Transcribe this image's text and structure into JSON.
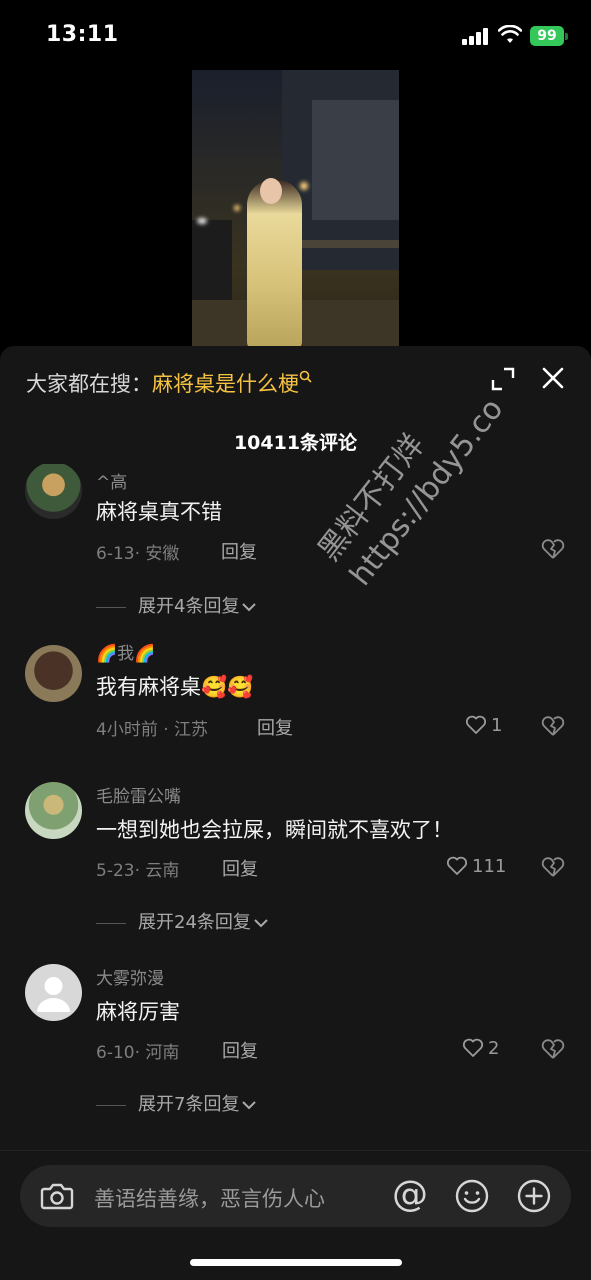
{
  "status_bar": {
    "time": "13:11",
    "battery": "99"
  },
  "video": {
    "icon": "video-thumbnail"
  },
  "search_banner": {
    "prefix": "大家都在搜：",
    "term": "麻将桌是什么梗"
  },
  "comments_title": "10411条评论",
  "comments": [
    {
      "username": "^高",
      "text": "麻将桌真不错",
      "date": "6-13",
      "location": "安徽",
      "reply_label": "回复",
      "likes": "",
      "expand_label": "展开4条回复"
    },
    {
      "username": "🌈我🌈",
      "text": "我有麻将桌🥰🥰",
      "date": "4小时前",
      "location": "江苏",
      "reply_label": "回复",
      "likes": "1",
      "expand_label": ""
    },
    {
      "username": "毛脸雷公嘴",
      "text": "一想到她也会拉屎，瞬间就不喜欢了！",
      "date": "5-23",
      "location": "云南",
      "reply_label": "回复",
      "likes": "111",
      "expand_label": "展开24条回复"
    },
    {
      "username": "大雾弥漫",
      "text": "麻将厉害",
      "date": "6-10",
      "location": "河南",
      "reply_label": "回复",
      "likes": "2",
      "expand_label": "展开7条回复"
    }
  ],
  "input_bar": {
    "placeholder": "善语结善缘，恶言伤人心",
    "at_symbol": "@"
  },
  "watermark": {
    "line1": "黑料不打烊",
    "line2": "https://bdy5.co"
  },
  "colors": {
    "accent": "#f5c242",
    "panel_bg": "#161616",
    "battery_green": "#34c759"
  }
}
